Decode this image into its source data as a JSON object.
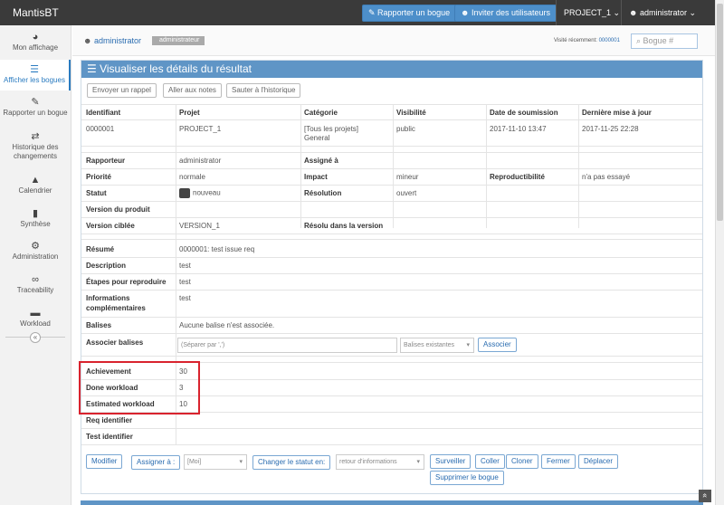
{
  "topbar": {
    "brand": "MantisBT",
    "report_btn": "Rapporter un bogue",
    "invite_btn": "Inviter des utilisateurs",
    "project": "PROJECT_1",
    "user": "administrator"
  },
  "sidebar": [
    {
      "icon": "dashboard-icon",
      "glyph": "◕",
      "label": "Mon affichage"
    },
    {
      "icon": "list-icon",
      "glyph": "☰",
      "label": "Afficher les bogues"
    },
    {
      "icon": "edit-icon",
      "glyph": "✎",
      "label": "Rapporter un bogue"
    },
    {
      "icon": "retweet-icon",
      "glyph": "⇄",
      "label": "Historique des changements"
    },
    {
      "icon": "road-icon",
      "glyph": "▲",
      "label": "Calendrier"
    },
    {
      "icon": "bar-chart-icon",
      "glyph": "▮",
      "label": "Synthèse"
    },
    {
      "icon": "gears-icon",
      "glyph": "⚙",
      "label": "Administration"
    },
    {
      "icon": "link-icon",
      "glyph": "∞",
      "label": "Traceability"
    },
    {
      "icon": "briefcase-icon",
      "glyph": "▬",
      "label": "Workload"
    }
  ],
  "breadcrumb": {
    "user": "administrator",
    "role": "administrateur",
    "recent_label": "Visité récemment:",
    "recent_link": "0000001",
    "search_placeholder": "Bogue #"
  },
  "panel": {
    "title": "Visualiser les détails du résultat",
    "actions": [
      "Envoyer un rappel",
      "Aller aux notes",
      "Sauter à l'historique"
    ]
  },
  "table": {
    "headers": [
      "Identifiant",
      "Projet",
      "Catégorie",
      "Visibilité",
      "Date de soumission",
      "Dernière mise à jour"
    ],
    "row": {
      "id": "0000001",
      "project": "PROJECT_1",
      "category1": "[Tous les projets]",
      "category2": "General",
      "visibility": "public",
      "submitted": "2017-11-10 13:47",
      "updated": "2017-11-25 22:28"
    },
    "reporter_label": "Rapporteur",
    "reporter": "administrator",
    "assigned_label": "Assigné à",
    "assigned": "",
    "priority_label": "Priorité",
    "priority": "normale",
    "impact_label": "Impact",
    "impact": "mineur",
    "repro_label": "Reproductibilité",
    "repro": "n'a pas essayé",
    "status_label": "Statut",
    "status": "nouveau",
    "resolution_label": "Résolution",
    "resolution": "ouvert",
    "product_version_label": "Version du produit",
    "product_version": "",
    "target_version_label": "Version ciblée",
    "target_version": "VERSION_1",
    "fixed_in_label": "Résolu dans la version",
    "fixed_in": "",
    "summary_label": "Résumé",
    "summary": "0000001: test issue req",
    "description_label": "Description",
    "description": "test",
    "steps_label": "Étapes pour reproduire",
    "steps": "test",
    "info_label1": "Informations",
    "info_label2": "complémentaires",
    "info": "test",
    "tags_label": "Balises",
    "tags": "Aucune balise n'est associée.",
    "attach_tags_label": "Associer balises",
    "tags_input_placeholder": "(Séparer par ',')",
    "tags_select": "Balises existantes",
    "tags_button": "Associer",
    "custom": [
      {
        "label": "Achievement",
        "value": "30"
      },
      {
        "label": "Done workload",
        "value": "3"
      },
      {
        "label": "Estimated workload",
        "value": "10"
      },
      {
        "label": "Req identifier",
        "value": ""
      },
      {
        "label": "Test identifier",
        "value": ""
      }
    ]
  },
  "bottom": {
    "modify": "Modifier",
    "assign": "Assigner à :",
    "assign_select": "[Moi]",
    "change_status": "Changer le statut en:",
    "status_select": "retour d'informations",
    "monitor": "Surveiller",
    "stick": "Coller",
    "clone": "Cloner",
    "close": "Fermer",
    "move": "Déplacer",
    "delete": "Supprimer le bogue"
  },
  "colors": {
    "topbar": "#3a3a3a",
    "accent": "#5f95c6",
    "highlight": "#d9232e",
    "status_new": "#444444"
  }
}
